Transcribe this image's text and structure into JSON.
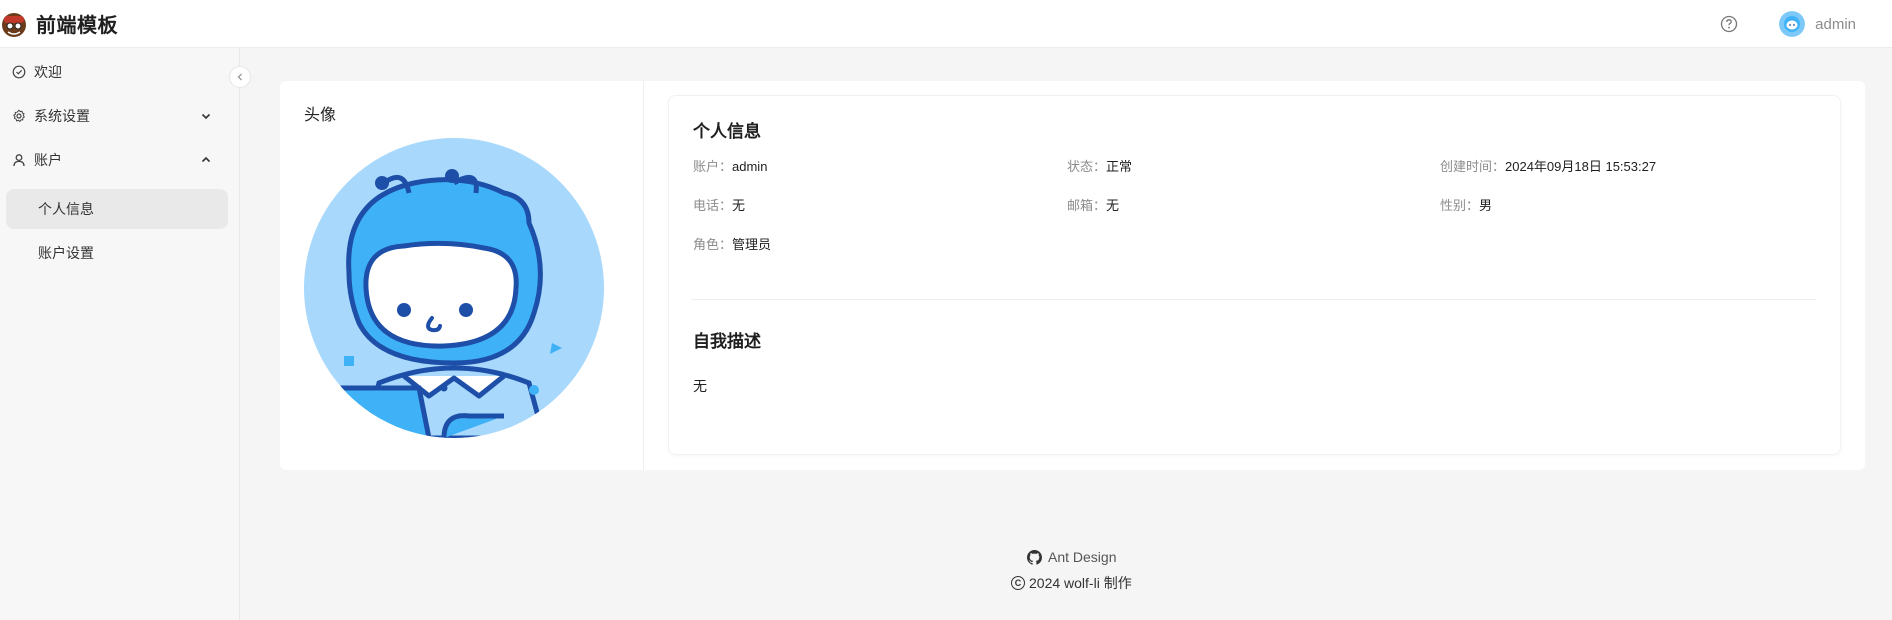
{
  "header": {
    "title": "前端模板",
    "username": "admin",
    "help_icon": "question-circle-icon"
  },
  "sidebar": {
    "items": [
      {
        "label": "欢迎",
        "icon": "check-circle-icon"
      },
      {
        "label": "系统设置",
        "icon": "gear-icon",
        "expanded": false
      },
      {
        "label": "账户",
        "icon": "user-icon",
        "expanded": true
      },
      {
        "label": "个人信息",
        "active": true
      },
      {
        "label": "账户设置"
      }
    ]
  },
  "profile": {
    "avatar_label": "头像",
    "info_title": "个人信息",
    "fields": {
      "account_label": "账户：",
      "account_value": "admin",
      "status_label": "状态：",
      "status_value": "正常",
      "created_label": "创建时间：",
      "created_value": "2024年09月18日 15:53:27",
      "phone_label": "电话：",
      "phone_value": "无",
      "email_label": "邮箱：",
      "email_value": "无",
      "gender_label": "性别：",
      "gender_value": "男",
      "role_label": "角色：",
      "role_value": "管理员"
    },
    "desc_title": "自我描述",
    "desc_value": "无"
  },
  "footer": {
    "link_label": "Ant Design",
    "copyright": "2024 wolf-li 制作"
  },
  "colors": {
    "accent_blue": "#3fb2f7",
    "avatar_bg": "#a8d8fc"
  }
}
